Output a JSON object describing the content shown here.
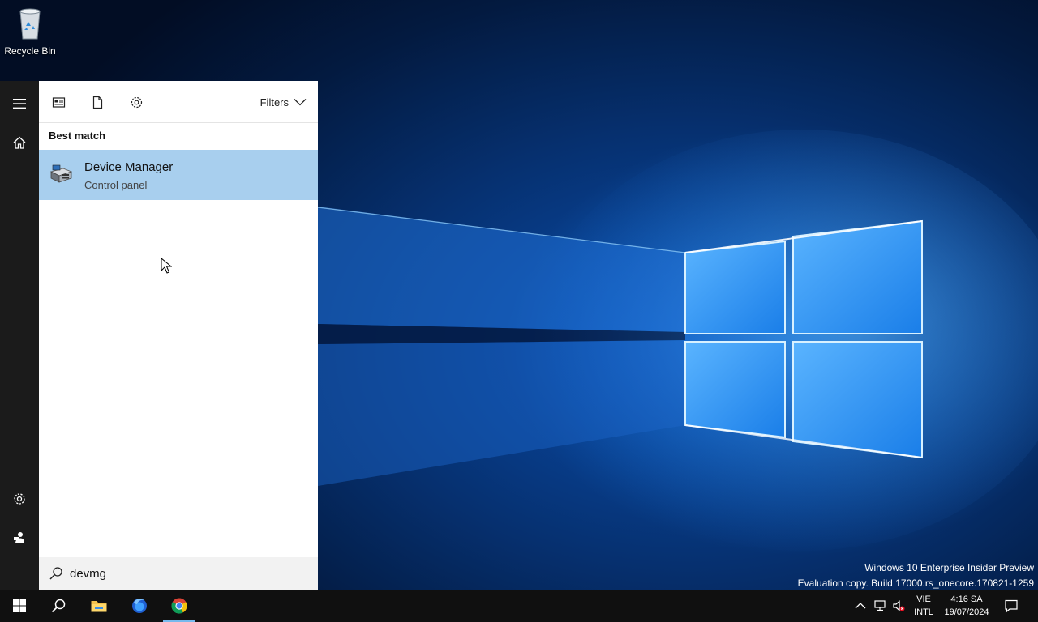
{
  "desktop": {
    "recycle_bin_label": "Recycle Bin",
    "watermark_line1": "Windows 10 Enterprise Insider Preview",
    "watermark_line2": "Evaluation copy. Build 17000.rs_onecore.170821-1259"
  },
  "start_nav": {
    "items": [
      {
        "icon": "hamburger-menu-icon"
      },
      {
        "icon": "home-icon"
      },
      {
        "icon": "gear-icon"
      },
      {
        "icon": "user-icon"
      }
    ]
  },
  "search_panel": {
    "top_icons": [
      "apps-icon",
      "document-icon",
      "gear-icon"
    ],
    "filters_label": "Filters",
    "section_header": "Best match",
    "result": {
      "title": "Device Manager",
      "subtitle": "Control panel",
      "icon": "device-manager-icon"
    },
    "query": "devmg",
    "highlight_color": "#a8cfee"
  },
  "taskbar": {
    "apps": [
      "start-button",
      "search-button",
      "file-explorer",
      "firefox",
      "chrome"
    ],
    "active_app": "chrome",
    "lang_line1": "VIE",
    "lang_line2": "INTL",
    "time": "4:16 SA",
    "date": "19/07/2024"
  }
}
